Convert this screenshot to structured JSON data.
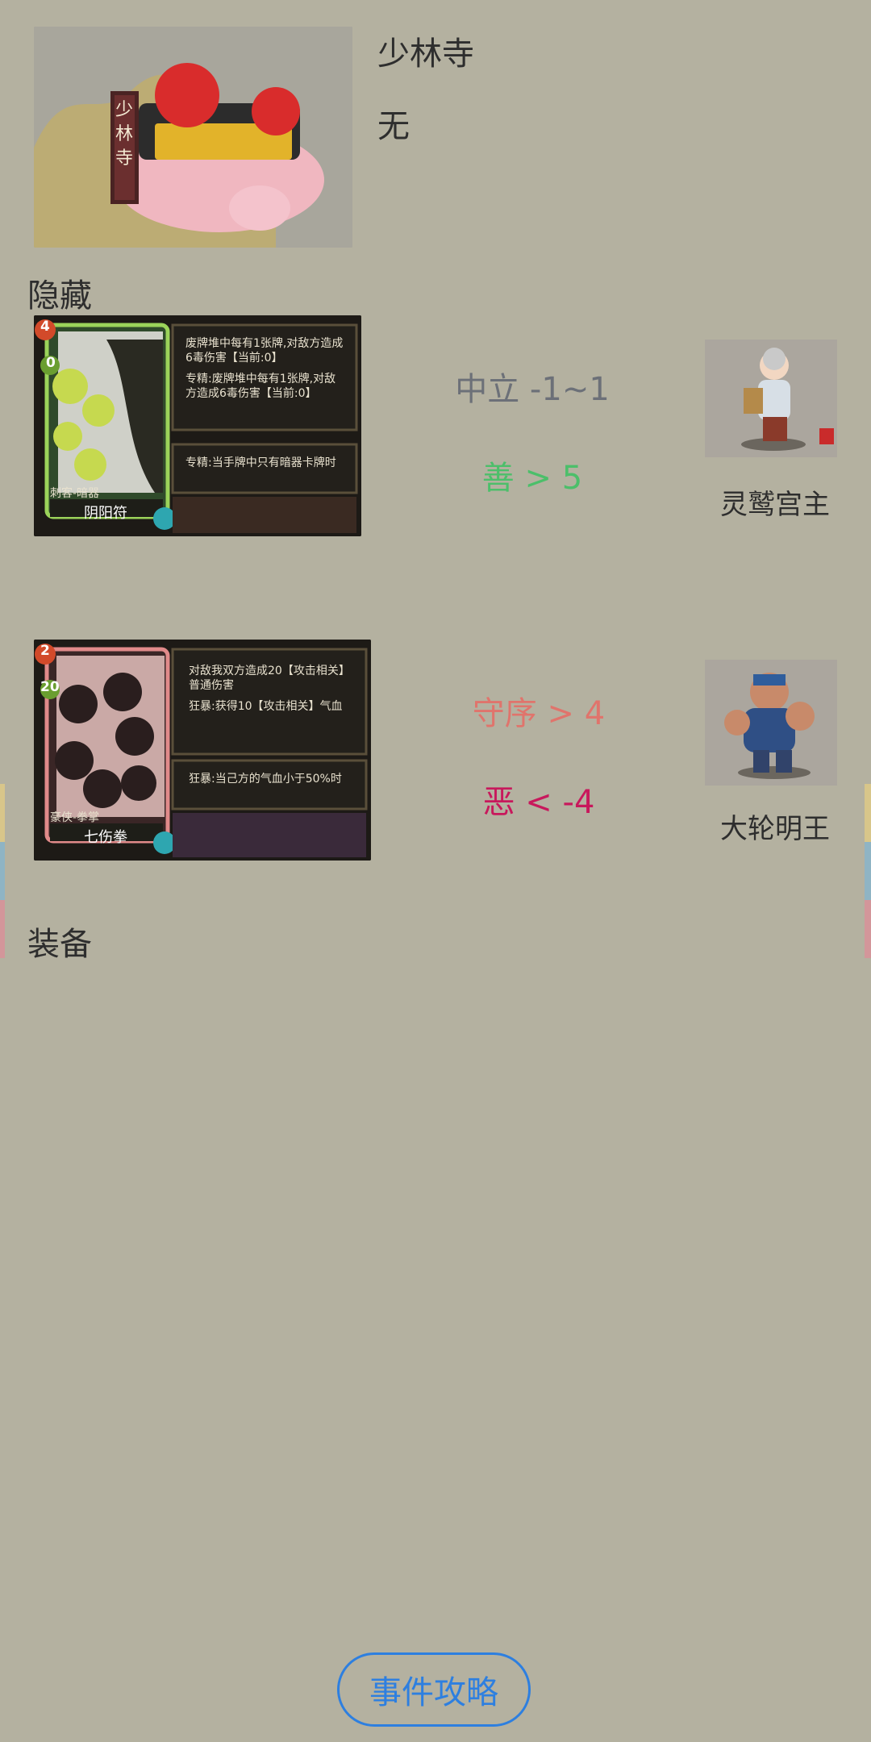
{
  "header": {
    "title": "少林寺",
    "subtitle": "无",
    "image_text": "少林寺"
  },
  "hidden": {
    "title": "隐藏",
    "cards": [
      {
        "card_cost": "4",
        "card_power": "0",
        "card_type": "刺客-暗器",
        "card_name": "阴阳符",
        "desc1": "废牌堆中每有1张牌,对敌方造成6毒伤害【当前:0】",
        "desc2": "专精:废牌堆中每有1张牌,对敌方造成6毒伤害【当前:0】",
        "desc3": "专精:当手牌中只有暗器卡牌时",
        "rule1": "中立 -1~1",
        "rule2": "善 > 5",
        "character_name": "灵鹫宫主"
      },
      {
        "card_cost": "2",
        "card_power": "20",
        "card_type": "豪侠-拳掌",
        "card_name": "七伤拳",
        "desc1": "对敌我双方造成20【攻击相关】普通伤害",
        "desc2": "狂暴:获得10【攻击相关】气血",
        "desc3": "狂暴:当己方的气血小于50%时",
        "rule1": "守序 > 4",
        "rule2": "恶 < -4",
        "character_name": "大轮明王"
      }
    ]
  },
  "equipment": {
    "title": "装备"
  },
  "button": {
    "label": "事件攻略"
  },
  "colors": {
    "background": "#b4b1a0",
    "neutral": "#6c7078",
    "good": "#4cbf6a",
    "lawful": "#e0746c",
    "evil": "#c8185c",
    "button": "#2d7fe0"
  }
}
